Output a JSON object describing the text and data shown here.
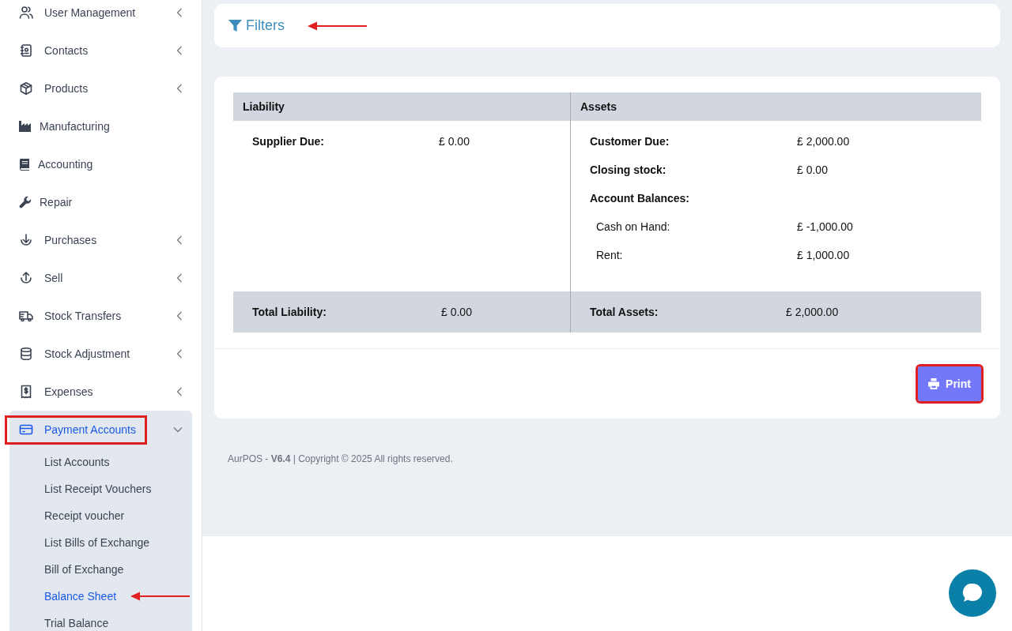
{
  "sidebar": {
    "items": [
      {
        "label": "User Management",
        "expanded": false,
        "selected": false
      },
      {
        "label": "Contacts",
        "expanded": false,
        "selected": false
      },
      {
        "label": "Products",
        "expanded": false,
        "selected": false
      },
      {
        "label": "Manufacturing",
        "selected": false
      },
      {
        "label": "Accounting",
        "selected": false
      },
      {
        "label": "Repair",
        "selected": false
      },
      {
        "label": "Purchases",
        "expanded": false,
        "selected": false
      },
      {
        "label": "Sell",
        "expanded": false,
        "selected": false
      },
      {
        "label": "Stock Transfers",
        "expanded": false,
        "selected": false
      },
      {
        "label": "Stock Adjustment",
        "expanded": false,
        "selected": false
      },
      {
        "label": "Expenses",
        "expanded": false,
        "selected": false
      },
      {
        "label": "Payment Accounts",
        "expanded": true,
        "selected": true,
        "outlined": true,
        "children": [
          {
            "label": "List Accounts",
            "selected": false
          },
          {
            "label": "List Receipt Vouchers",
            "selected": false
          },
          {
            "label": "Receipt voucher",
            "selected": false
          },
          {
            "label": "List Bills of Exchange",
            "selected": false
          },
          {
            "label": "Bill of Exchange",
            "selected": false
          },
          {
            "label": "Balance Sheet",
            "selected": true,
            "pointed_at": true
          },
          {
            "label": "Trial Balance",
            "selected": false
          }
        ]
      }
    ]
  },
  "filters": {
    "label": "Filters",
    "pointed_at": true
  },
  "balance_sheet": {
    "liability": {
      "heading": "Liability",
      "rows": [
        {
          "kind": "entry",
          "label": "Supplier Due:",
          "value": "£ 0.00"
        }
      ],
      "total_label": "Total Liability:",
      "total_value": "£ 0.00"
    },
    "assets": {
      "heading": "Assets",
      "rows": [
        {
          "kind": "entry",
          "label": "Customer Due:",
          "value": "£ 2,000.00"
        },
        {
          "kind": "entry",
          "label": "Closing stock:",
          "value": "£ 0.00"
        },
        {
          "kind": "group",
          "label": "Account Balances:"
        },
        {
          "kind": "account",
          "label": "Cash on Hand:",
          "value": "£ -1,000.00"
        },
        {
          "kind": "account",
          "label": "Rent:",
          "value": "£ 1,000.00"
        }
      ],
      "total_label": "Total Assets:",
      "total_value": "£ 2,000.00"
    }
  },
  "print_button": {
    "label": "Print",
    "outlined": true
  },
  "footer": "AurPOS - **V6.4** | Copyright © 2025 All rights reserved."
}
